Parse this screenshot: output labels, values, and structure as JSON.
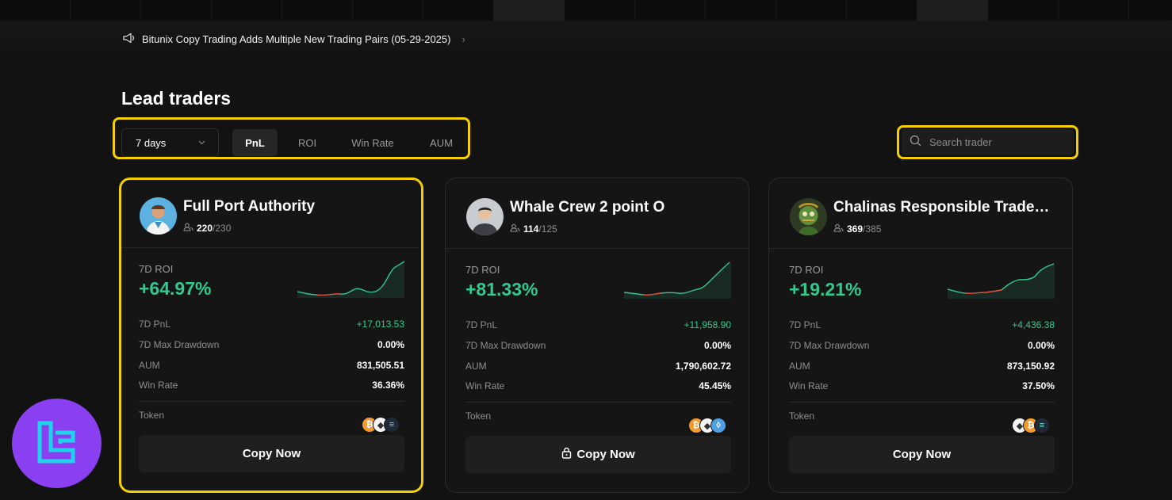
{
  "announcement": {
    "text": "Bitunix Copy Trading Adds Multiple New Trading Pairs (05-29-2025)"
  },
  "section_title": "Lead traders",
  "filters": {
    "period": "7 days",
    "tabs": [
      {
        "label": "PnL",
        "active": true
      },
      {
        "label": "ROI",
        "active": false
      },
      {
        "label": "Win Rate",
        "active": false
      },
      {
        "label": "AUM",
        "active": false
      }
    ]
  },
  "search": {
    "placeholder": "Search trader"
  },
  "traders": [
    {
      "name": "Full Port Authority",
      "followers_current": "220",
      "followers_max": "/230",
      "roi_label": "7D ROI",
      "roi": "+64.97%",
      "pnl_label": "7D PnL",
      "pnl": "+17,013.53",
      "drawdown_label": "7D Max Drawdown",
      "drawdown": "0.00%",
      "aum_label": "AUM",
      "aum": "831,505.51",
      "winrate_label": "Win Rate",
      "winrate": "36.36%",
      "token_label": "Token",
      "tokens": [
        "btc",
        "eth",
        "sol"
      ],
      "button": "Copy Now",
      "locked": false
    },
    {
      "name": "Whale Crew 2 point O",
      "followers_current": "114",
      "followers_max": "/125",
      "roi_label": "7D ROI",
      "roi": "+81.33%",
      "pnl_label": "7D PnL",
      "pnl": "+11,958.90",
      "drawdown_label": "7D Max Drawdown",
      "drawdown": "0.00%",
      "aum_label": "AUM",
      "aum": "1,790,602.72",
      "winrate_label": "Win Rate",
      "winrate": "45.45%",
      "token_label": "Token",
      "tokens": [
        "btc",
        "eth",
        "xrp"
      ],
      "button": "Copy Now",
      "locked": true
    },
    {
      "name": "Chalinas Responsible Trade…",
      "followers_current": "369",
      "followers_max": "/385",
      "roi_label": "7D ROI",
      "roi": "+19.21%",
      "pnl_label": "7D PnL",
      "pnl": "+4,436.38",
      "drawdown_label": "7D Max Drawdown",
      "drawdown": "0.00%",
      "aum_label": "AUM",
      "aum": "873,150.92",
      "winrate_label": "Win Rate",
      "winrate": "37.50%",
      "token_label": "Token",
      "tokens": [
        "eth",
        "btc",
        "sol"
      ],
      "button": "Copy Now",
      "locked": false
    }
  ],
  "colors": {
    "positive": "#32c98e",
    "negative": "#e2543f",
    "highlight": "#f5d000",
    "logo_bg": "#8a3ff0",
    "logo_fg": "#1fd3ea"
  },
  "icons": [
    "megaphone-icon",
    "chevron-right-icon",
    "chevron-down-icon",
    "search-icon",
    "users-icon",
    "lock-icon",
    "btc-icon",
    "eth-icon",
    "sol-icon",
    "xrp-icon"
  ]
}
